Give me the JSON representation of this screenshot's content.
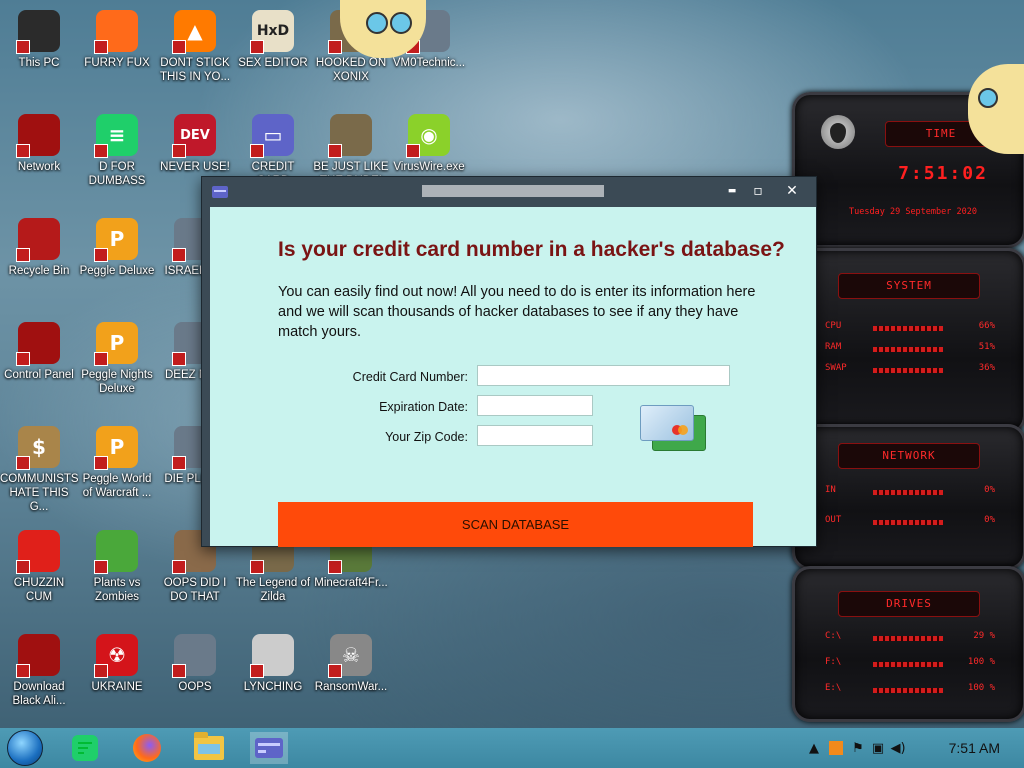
{
  "desktop_icons": [
    {
      "label": "This PC",
      "icon": "computer-icon"
    },
    {
      "label": "FURRY FUX",
      "icon": "firefox-icon"
    },
    {
      "label": "DONT STICK\nTHIS IN YO...",
      "icon": "traffic-cone-icon"
    },
    {
      "label": "SEX EDITOR",
      "icon": "hxd-editor-icon"
    },
    {
      "label": "HOOKED ON\nXONIX",
      "icon": "game-icon"
    },
    {
      "label": "VM0Technic...",
      "icon": "app-icon"
    },
    {
      "label": "Network",
      "icon": "network-icon"
    },
    {
      "label": "D FOR\nDUMBASS",
      "icon": "chat-icon"
    },
    {
      "label": "NEVER USE!",
      "icon": "devcpp-icon"
    },
    {
      "label": "CREDIT CARD\nCHECKER",
      "icon": "credit-card-icon"
    },
    {
      "label": "BE JUST LIKE\nTHE DUDE!",
      "icon": "game-icon"
    },
    {
      "label": "VirusWire.exe",
      "icon": "lime-icon"
    },
    {
      "label": "Recycle Bin",
      "icon": "recycle-bin-icon"
    },
    {
      "label": "Peggle Deluxe",
      "icon": "peggle-icon"
    },
    {
      "label": "ISRAEL S...",
      "icon": "app-icon"
    },
    {
      "label": "Control Panel",
      "icon": "control-panel-icon"
    },
    {
      "label": "Peggle Nights\nDeluxe",
      "icon": "peggle-icon"
    },
    {
      "label": "DEEZ NU...",
      "icon": "app-icon"
    },
    {
      "label": "COMMUNISTS\nHATE THIS G...",
      "icon": "money-bag-icon"
    },
    {
      "label": "Peggle World\nof Warcraft ...",
      "icon": "peggle-icon"
    },
    {
      "label": "DIE PLEA...",
      "icon": "app-icon"
    },
    {
      "label": "CHUZZIN\nCUM",
      "icon": "chuzzle-icon"
    },
    {
      "label": "Plants vs\nZombies",
      "icon": "plant-icon"
    },
    {
      "label": "OOPS DID I\nDO THAT",
      "icon": "portrait-icon"
    },
    {
      "label": "The Legend of\nZilda",
      "icon": "game-icon"
    },
    {
      "label": "Minecraft4Fr...",
      "icon": "minecraft-icon"
    },
    {
      "label": "Download\nBlack Ali...",
      "icon": "download-icon"
    },
    {
      "label": "UKRAINE",
      "icon": "radiation-icon"
    },
    {
      "label": "OOPS",
      "icon": "app-icon"
    },
    {
      "label": "LYNCHING",
      "icon": "rope-icon"
    },
    {
      "label": "RansomWar...",
      "icon": "skull-icon"
    }
  ],
  "gadget": {
    "time_header": "TIME",
    "time": "7:51:02",
    "date": "Tuesday 29 September 2020",
    "system_header": "SYSTEM",
    "system_rows": [
      {
        "key": "CPU",
        "value": "66%"
      },
      {
        "key": "RAM",
        "value": "51%"
      },
      {
        "key": "SWAP",
        "value": "36%"
      }
    ],
    "network_header": "NETWORK",
    "network_rows": [
      {
        "key": "IN",
        "value": "0%"
      },
      {
        "key": "OUT",
        "value": "0%"
      }
    ],
    "drives_header": "DRIVES",
    "drive_rows": [
      {
        "key": "C:\\",
        "value": "29 %"
      },
      {
        "key": "F:\\",
        "value": "100 %"
      },
      {
        "key": "E:\\",
        "value": "100 %"
      }
    ]
  },
  "dialog": {
    "headline": "Is your credit card number in a hacker's database?",
    "description": "You can easily find out now! All you need to do is enter its information here and we will scan thousands of hacker databases to see if any they have match yours.",
    "labels": {
      "card_number": "Credit Card Number:",
      "expiration": "Expiration Date:",
      "zip": "Your Zip Code:"
    },
    "values": {
      "card_number": "",
      "expiration": "",
      "zip": ""
    },
    "scan_button": "SCAN DATABASE",
    "minimize": "▬",
    "maximize": "▫",
    "close": "✕"
  },
  "taskbar": {
    "clock": "7:51 AM",
    "items": [
      "start-orb-icon",
      "chat-app-icon",
      "firefox-icon",
      "file-explorer-icon",
      "credit-card-checker-icon"
    ],
    "tray": [
      "show-hidden-icons-icon",
      "app-tray-icon",
      "flag-icon",
      "network-icon",
      "volume-icon"
    ]
  }
}
